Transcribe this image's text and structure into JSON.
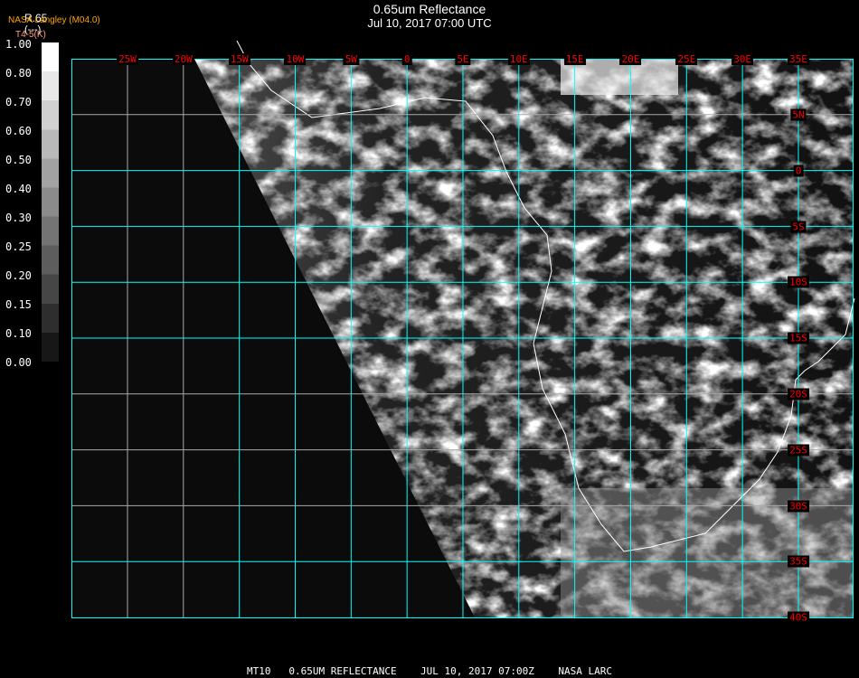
{
  "title": "0.65um Reflectance",
  "subtitle": "Jul 10, 2017 07:00 UTC",
  "header": {
    "channel": "R.65",
    "units": "(---)",
    "producer": "NASA Langley (M04.0)",
    "secondary": "T4-5(K)"
  },
  "colors": {
    "producer": "#ffa500",
    "secondary": "#ffa07a",
    "grid": "#00ffff",
    "labels": "#ff0000"
  },
  "colorbar": {
    "labels": [
      "1.00",
      "0.80",
      "0.70",
      "0.60",
      "0.50",
      "0.40",
      "0.30",
      "0.25",
      "0.20",
      "0.15",
      "0.10",
      "0.00"
    ]
  },
  "map": {
    "longitude_labels": [
      "25W",
      "20W",
      "15W",
      "10W",
      "5W",
      "0",
      "5E",
      "10E",
      "15E",
      "20E",
      "25E",
      "30E",
      "35E"
    ],
    "latitude_labels": [
      "5N",
      "0",
      "5S",
      "10S",
      "15S",
      "20S",
      "25S",
      "30S",
      "35S",
      "40S"
    ]
  },
  "footer": "MT10   0.65UM REFLECTANCE    JUL 10, 2017 07:00Z    NASA LARC"
}
